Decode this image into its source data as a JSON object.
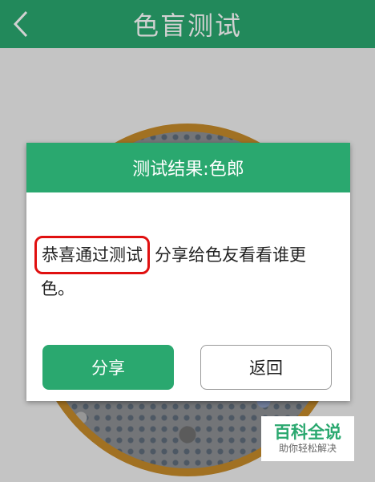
{
  "app": {
    "title": "色盲测试"
  },
  "dialog": {
    "title": "测试结果:色郎",
    "message_highlight": "恭喜通过测试",
    "message_rest": "分享给色友看看谁更色。",
    "share_label": "分享",
    "return_label": "返回"
  },
  "watermark": {
    "main": "百科全说",
    "sub": "助你轻松解决"
  },
  "colors": {
    "brand_green": "#2aa86f",
    "highlight_red": "#e01010"
  }
}
